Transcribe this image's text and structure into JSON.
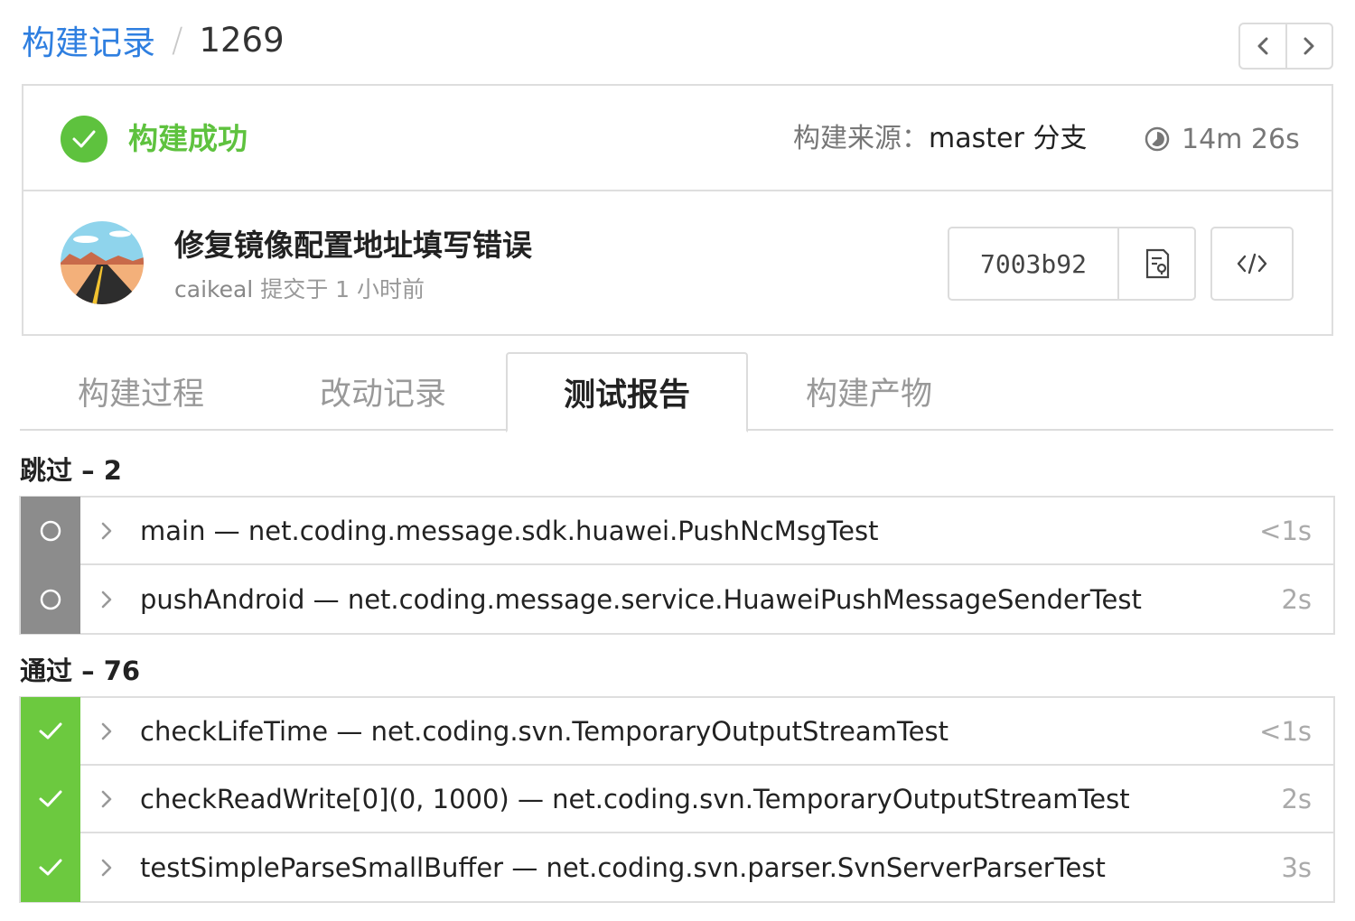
{
  "breadcrumb": {
    "parent": "构建记录",
    "separator": "/",
    "current": "1269"
  },
  "status": {
    "text": "构建成功",
    "source_label": "构建来源：",
    "source_branch": "master 分支",
    "duration": "14m 26s",
    "color": "#5ec23e"
  },
  "commit": {
    "message": "修复镜像配置地址填写错误",
    "author": "caikeal",
    "meta": "提交于 1 小时前",
    "sha": "7003b92"
  },
  "tabs": [
    {
      "label": "构建过程",
      "active": false
    },
    {
      "label": "改动记录",
      "active": false
    },
    {
      "label": "测试报告",
      "active": true
    },
    {
      "label": "构建产物",
      "active": false
    }
  ],
  "skipped": {
    "title": "跳过 – 2",
    "color": "#8c8c8c",
    "tests": [
      {
        "name": "main — net.coding.message.sdk.huawei.PushNcMsgTest",
        "time": "<1s"
      },
      {
        "name": "pushAndroid — net.coding.message.service.HuaweiPushMessageSenderTest",
        "time": "2s"
      }
    ]
  },
  "passed": {
    "title": "通过 – 76",
    "color": "#6cc93f",
    "tests": [
      {
        "name": "checkLifeTime — net.coding.svn.TemporaryOutputStreamTest",
        "time": "<1s"
      },
      {
        "name": "checkReadWrite[0](0, 1000) — net.coding.svn.TemporaryOutputStreamTest",
        "time": "2s"
      },
      {
        "name": "testSimpleParseSmallBuffer — net.coding.svn.parser.SvnServerParserTest",
        "time": "3s"
      }
    ]
  }
}
